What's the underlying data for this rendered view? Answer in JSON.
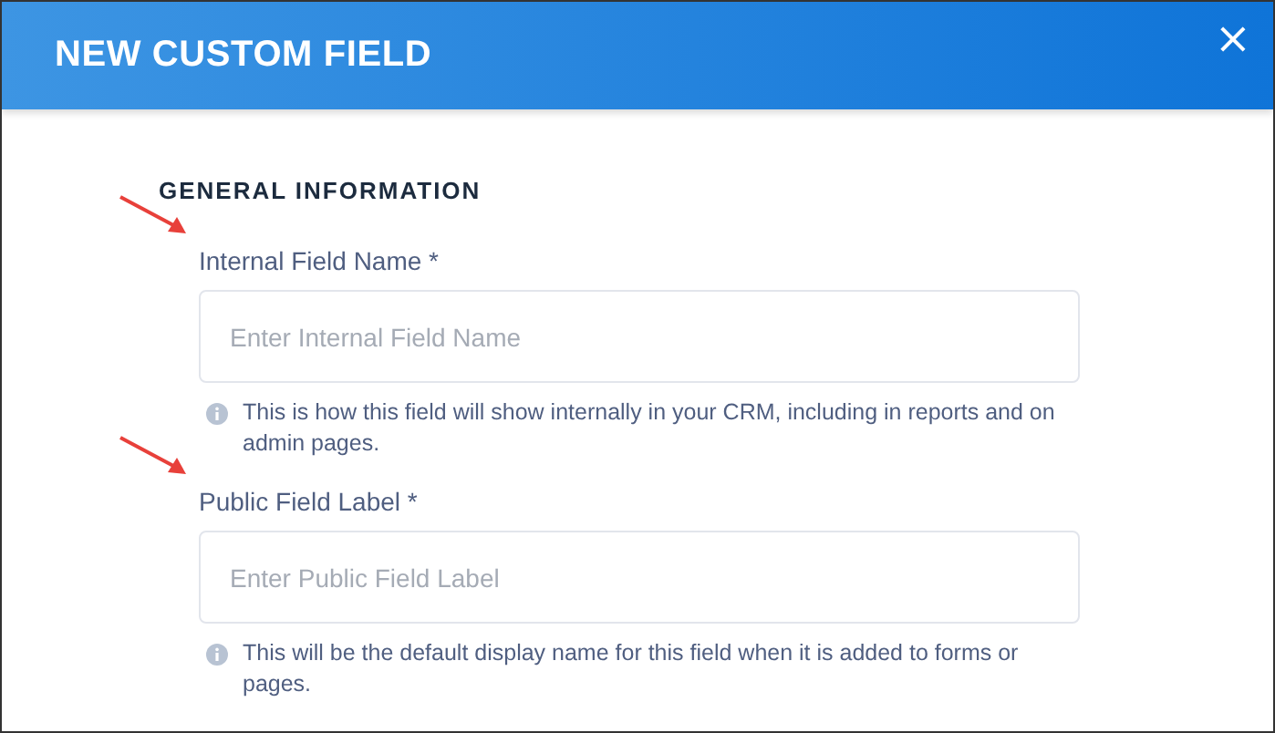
{
  "window": {
    "title": "NEW CUSTOM FIELD",
    "close": "×"
  },
  "section": {
    "heading": "GENERAL INFORMATION"
  },
  "fields": [
    {
      "label": "Internal Field Name *",
      "placeholder": "Enter Internal Field Name",
      "hint": "This is how this field will show internally in your CRM, including in reports and on admin pages.",
      "marked": true
    },
    {
      "label": "Public Field Label *",
      "placeholder": "Enter Public Field Label",
      "hint": "This will be the default display name for this field when it is added to forms or pages.",
      "marked": true
    }
  ]
}
